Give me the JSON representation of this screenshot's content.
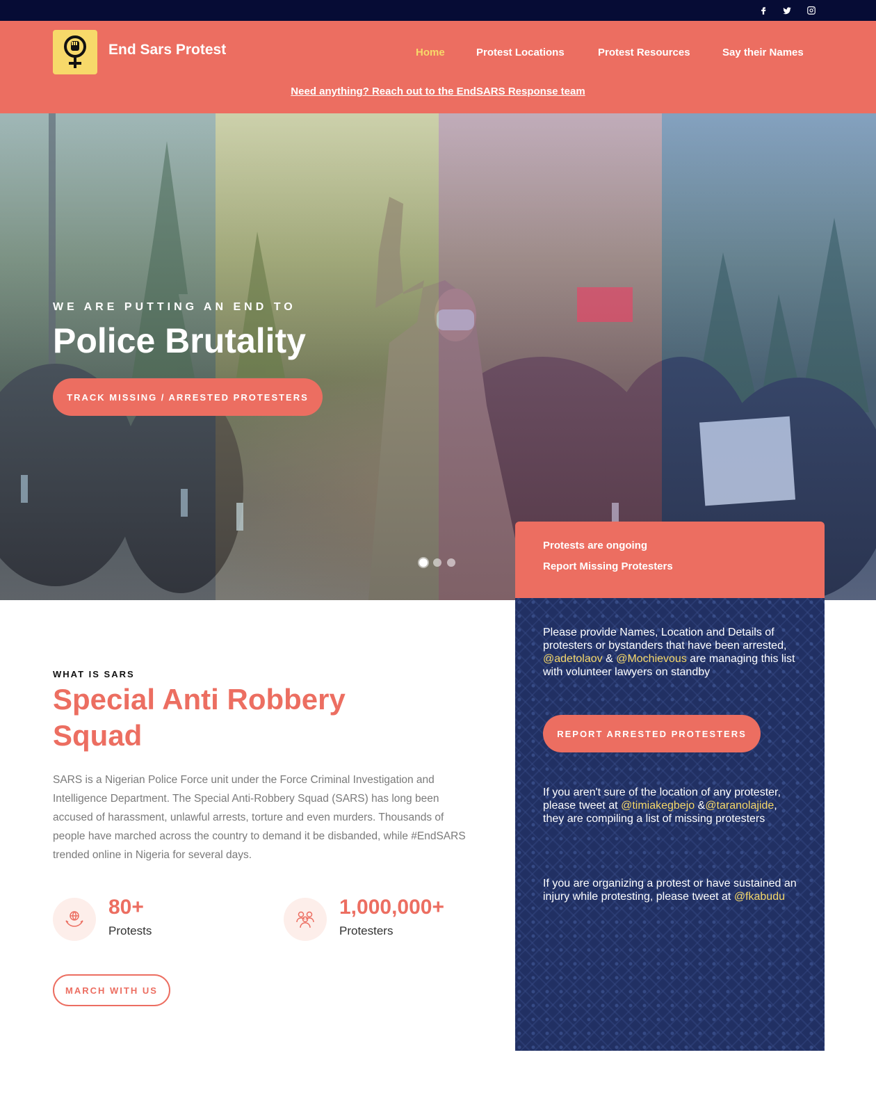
{
  "social": {
    "icons": [
      "facebook-icon",
      "twitter-icon",
      "instagram-icon"
    ]
  },
  "header": {
    "brand": "End Sars Protest",
    "logo_icon": "fist-in-venus-symbol-icon",
    "nav": [
      {
        "label": "Home",
        "active": true
      },
      {
        "label": "Protest Locations",
        "active": false
      },
      {
        "label": "Protest Resources",
        "active": false
      },
      {
        "label": "Say their Names",
        "active": false
      }
    ],
    "notice_link": "Need anything? Reach out to the EndSARS Response team"
  },
  "hero": {
    "kicker": "WE ARE PUTTING AN END TO",
    "title": "Police Brutality",
    "cta": "TRACK MISSING / ARRESTED PROTESTERS",
    "slides": 3,
    "active_slide": 1
  },
  "card": {
    "links": [
      "Protests are ongoing",
      "Report Missing Protesters"
    ],
    "block1": {
      "pre": "Please provide Names, Location and Details of protesters or bystanders that have been arrested, ",
      "handle1": "@adetolaov",
      "mid": " & ",
      "handle2": "@Mochievous",
      "post": " are managing this list with volunteer lawyers on standby"
    },
    "button": "REPORT ARRESTED PROTESTERS",
    "block2": {
      "pre": "If you aren't sure of the location of any protester, please tweet at ",
      "handle1": "@timiakegbejo",
      "mid": " &",
      "handle2": "@taranolajide",
      "post": ", they are compiling a list of missing protesters"
    },
    "block3": {
      "pre": "If you are organizing a protest or have sustained an injury while protesting, please tweet at ",
      "handle1": "@fkabudu"
    }
  },
  "about": {
    "kicker": "WHAT IS SARS",
    "title": "Special Anti Robbery Squad",
    "paragraph": "SARS is a Nigerian Police Force unit under the Force Criminal Investigation and Intelligence Department. The Special Anti-Robbery Squad (SARS) has long been accused of harassment, unlawful arrests, torture and even murders. Thousands of people have marched across the country to demand it be disbanded, while #EndSARS trended online in Nigeria for several days.",
    "stats": [
      {
        "value": "80+",
        "label": "Protests",
        "icon": "hands-globe-icon"
      },
      {
        "value": "1,000,000+",
        "label": "Protesters",
        "icon": "people-group-icon"
      }
    ],
    "button": "MARCH WITH US"
  },
  "colors": {
    "accent": "#ec6e61",
    "topbar": "#060c35",
    "highlight": "#f7d96a",
    "card_bg": "#213063"
  }
}
